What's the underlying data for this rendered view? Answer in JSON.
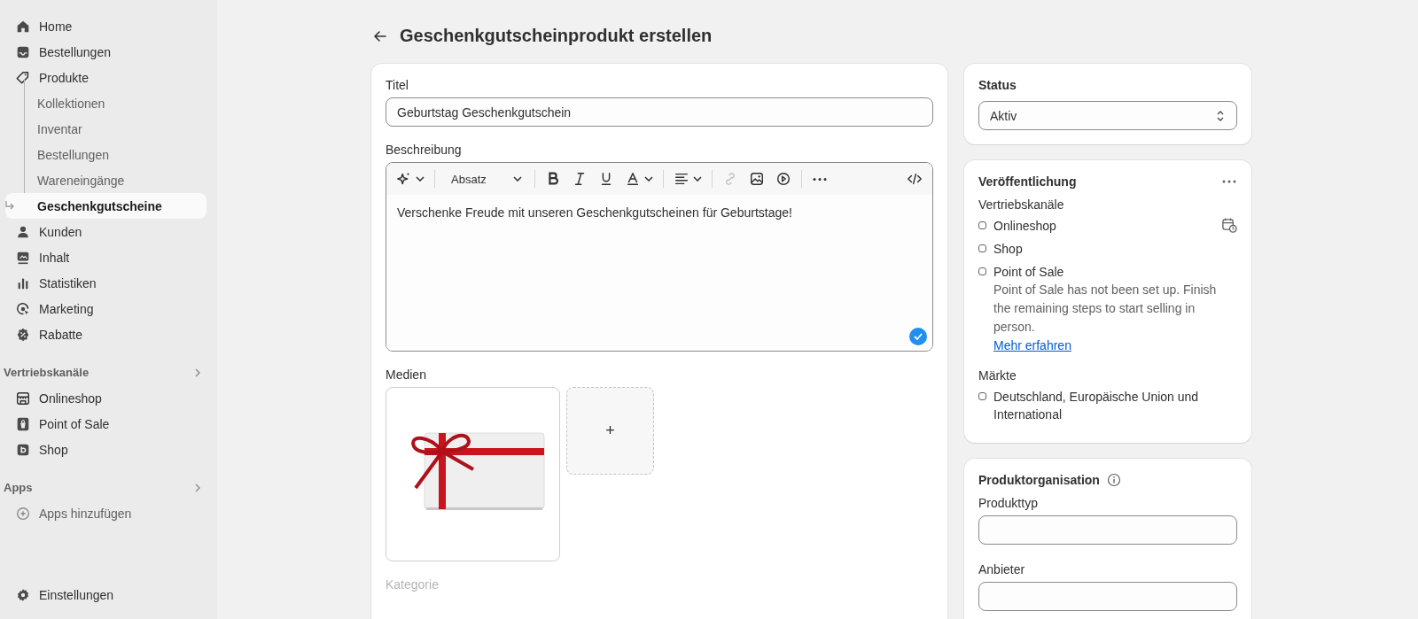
{
  "sidebar": {
    "items": [
      {
        "label": "Home",
        "selected": false
      },
      {
        "label": "Bestellungen",
        "selected": false
      },
      {
        "label": "Produkte",
        "selected": false,
        "expanded": true,
        "children": [
          {
            "label": "Kollektionen",
            "selected": false
          },
          {
            "label": "Inventar",
            "selected": false
          },
          {
            "label": "Bestellungen",
            "selected": false
          },
          {
            "label": "Wareneingänge",
            "selected": false
          },
          {
            "label": "Geschenkgutscheine",
            "selected": true
          }
        ]
      },
      {
        "label": "Kunden",
        "selected": false
      },
      {
        "label": "Inhalt",
        "selected": false
      },
      {
        "label": "Statistiken",
        "selected": false
      },
      {
        "label": "Marketing",
        "selected": false
      },
      {
        "label": "Rabatte",
        "selected": false
      }
    ],
    "sections": [
      {
        "title": "Vertriebskanäle",
        "items": [
          {
            "label": "Onlineshop",
            "kind": "nav"
          },
          {
            "label": "Point of Sale",
            "kind": "nav"
          },
          {
            "label": "Shop",
            "kind": "nav"
          }
        ]
      },
      {
        "title": "Apps",
        "items": [
          {
            "label": "Apps hinzufügen",
            "kind": "add"
          }
        ]
      }
    ],
    "footer_item": {
      "label": "Einstellungen"
    }
  },
  "page": {
    "title": "Geschenkgutscheinprodukt erstellen"
  },
  "product": {
    "title_label": "Titel",
    "title_value": "Geburtstag Geschenkgutschein",
    "description_label": "Beschreibung",
    "toolbar": [
      {
        "kind": "magic",
        "disabled": false
      },
      {
        "kind": "format",
        "label": "Absatz",
        "disabled": false
      },
      {
        "kind": "bold",
        "disabled": false
      },
      {
        "kind": "italic",
        "disabled": false
      },
      {
        "kind": "underline",
        "disabled": false
      },
      {
        "kind": "color",
        "disabled": false
      },
      {
        "kind": "align",
        "disabled": false
      },
      {
        "kind": "link",
        "disabled": true
      },
      {
        "kind": "image",
        "disabled": false
      },
      {
        "kind": "video",
        "disabled": false
      },
      {
        "kind": "more",
        "disabled": false
      },
      {
        "kind": "code",
        "disabled": false
      }
    ],
    "description": "Verschenke Freude mit unseren Geschenkgutscheinen für Geburtstage!",
    "media_label": "Medien",
    "media_add": "+",
    "category_label": "Kategorie"
  },
  "status": {
    "title": "Status",
    "value": "Aktiv"
  },
  "publishing": {
    "title": "Veröffentlichung",
    "channels_label": "Vertriebskanäle",
    "channels": [
      {
        "name": "Onlineshop",
        "checked": false,
        "scheduled": true
      },
      {
        "name": "Shop",
        "checked": false,
        "scheduled": false
      },
      {
        "name": "Point of Sale",
        "checked": false,
        "scheduled": false,
        "note": "Point of Sale has not been set up. Finish the remaining steps to start selling in person.",
        "link": "Mehr erfahren"
      }
    ],
    "markets_label": "Märkte",
    "markets": [
      {
        "name": "Deutschland, Europäische Union und International",
        "checked": false
      }
    ]
  },
  "organization": {
    "title": "Produktorganisation",
    "fields": [
      {
        "label": "Produkttyp"
      },
      {
        "label": "Anbieter"
      }
    ]
  }
}
